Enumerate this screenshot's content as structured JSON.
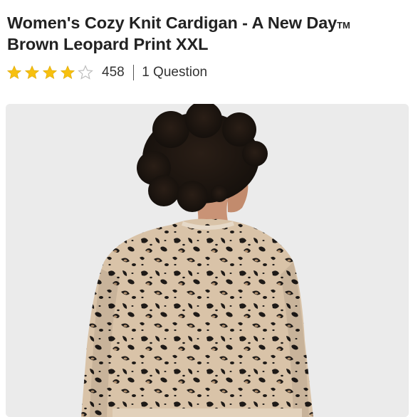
{
  "product": {
    "title_part1": "Women's Cozy Knit Cardigan - A New Day",
    "title_tm": "TM",
    "title_part2": "Brown Leopard Print XXL",
    "rating": 4,
    "rating_max": 5,
    "review_count": "458",
    "questions_label": "1 Question",
    "image_alt": "Model wearing brown leopard print knit cardigan, viewed from back"
  },
  "colors": {
    "star_filled": "#f7c00f",
    "star_empty": "#bdbdbd",
    "image_background": "#ebebeb",
    "cardigan_base": "#d9c3a8",
    "cardigan_spots": "#1e1a17"
  },
  "icons": {
    "filled": "star-icon",
    "empty": "star-outline-icon"
  }
}
